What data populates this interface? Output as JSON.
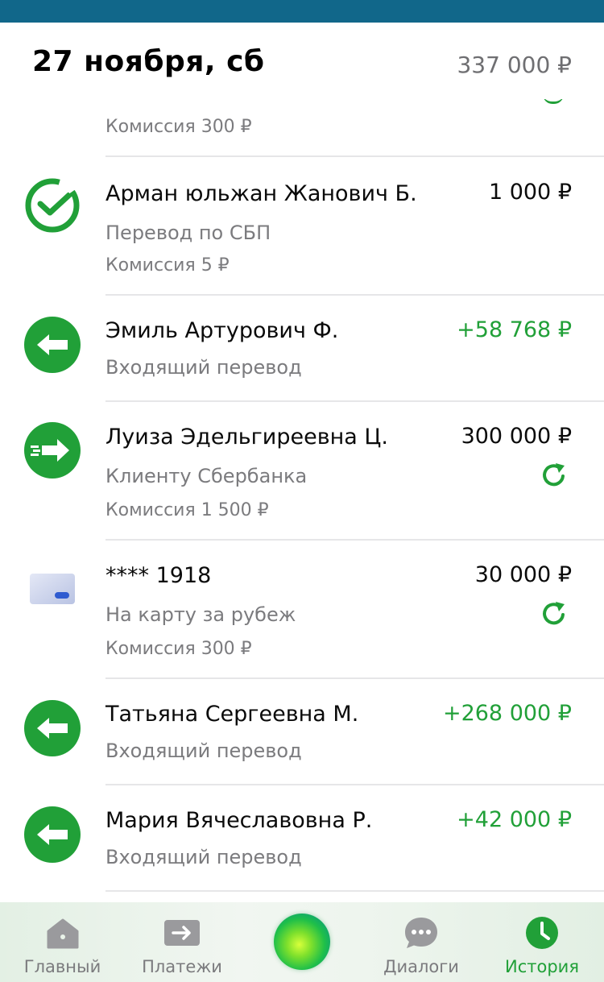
{
  "header": {
    "date": "27 ноября, сб",
    "total": "337 000 ₽"
  },
  "partial_item": {
    "commission": "Комиссия 300 ₽"
  },
  "transactions": [
    {
      "name": "Арман юльжан Жанович Б.",
      "description": "Перевод по СБП",
      "commission": "Комиссия 5 ₽",
      "amount": "1 000 ₽",
      "direction": "out",
      "icon": "sber-check-icon"
    },
    {
      "name": "Эмиль Артурович Ф.",
      "description": "Входящий перевод",
      "amount": "+58 768 ₽",
      "direction": "in",
      "icon": "incoming-arrow-icon"
    },
    {
      "name": "Луиза Эдельгиреевна Ц.",
      "description": "Клиенту Сбербанка",
      "commission": "Комиссия 1 500 ₽",
      "amount": "300 000 ₽",
      "direction": "out",
      "icon": "outgoing-arrow-icon",
      "repeat": true
    },
    {
      "name": "**** 1918",
      "description": "На карту за рубеж",
      "commission": "Комиссия 300 ₽",
      "amount": "30 000 ₽",
      "direction": "out",
      "icon": "card-icon",
      "repeat": true
    },
    {
      "name": "Татьяна Сергеевна М.",
      "description": "Входящий перевод",
      "amount": "+268 000 ₽",
      "direction": "in",
      "icon": "incoming-arrow-icon"
    },
    {
      "name": "Мария Вячеславовна Р.",
      "description": "Входящий перевод",
      "amount": "+42 000 ₽",
      "direction": "in",
      "icon": "incoming-arrow-icon"
    }
  ],
  "bottom_nav": {
    "items": [
      {
        "label": "Главный",
        "icon": "home-icon"
      },
      {
        "label": "Платежи",
        "icon": "payments-icon"
      },
      {
        "label": "",
        "icon": "assistant-orb-icon"
      },
      {
        "label": "Диалоги",
        "icon": "chat-icon"
      },
      {
        "label": "История",
        "icon": "clock-icon",
        "active": true
      }
    ]
  },
  "colors": {
    "brand_green": "#21a038",
    "status_bar": "#11678a",
    "secondary_text": "#7b7b7e"
  }
}
